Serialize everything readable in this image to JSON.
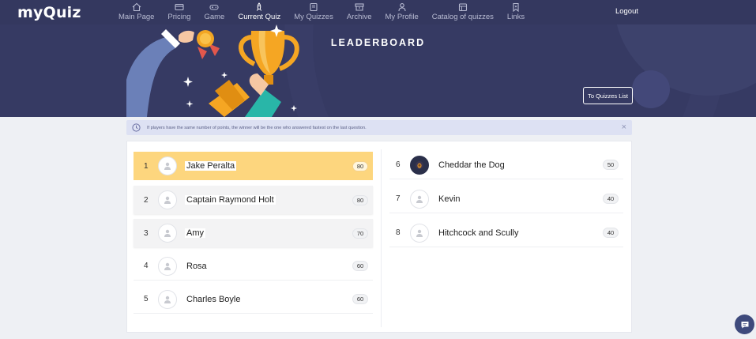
{
  "app": {
    "logo_text_1": "my",
    "logo_text_2": "Quiz"
  },
  "nav": {
    "items": [
      {
        "label": "Main Page",
        "icon": "home-icon"
      },
      {
        "label": "Pricing",
        "icon": "card-icon"
      },
      {
        "label": "Game",
        "icon": "gamepad-icon"
      },
      {
        "label": "Current Quiz",
        "icon": "rocket-icon",
        "active": true
      },
      {
        "label": "My Quizzes",
        "icon": "quizzes-icon"
      },
      {
        "label": "Archive",
        "icon": "archive-icon"
      },
      {
        "label": "My Profile",
        "icon": "user-icon"
      },
      {
        "label": "Catalog of quizzes",
        "icon": "catalog-icon"
      },
      {
        "label": "Links",
        "icon": "bookmark-icon"
      }
    ],
    "logout": "Logout"
  },
  "banner": {
    "title": "LEADERBOARD",
    "to_list_button": "To Quizzes List"
  },
  "info": {
    "text": "If players have the same number of points, the winner will be the one who answered fastest on the last question.",
    "close": "×"
  },
  "leaderboard": {
    "left": [
      {
        "rank": "1",
        "name": "Jake Peralta",
        "score": "80"
      },
      {
        "rank": "2",
        "name": "Captain Raymond Holt",
        "score": "80"
      },
      {
        "rank": "3",
        "name": "Amy",
        "score": "70"
      },
      {
        "rank": "4",
        "name": "Rosa",
        "score": "60"
      },
      {
        "rank": "5",
        "name": "Charles Boyle",
        "score": "60"
      }
    ],
    "right": [
      {
        "rank": "6",
        "name": "Cheddar the Dog",
        "score": "50"
      },
      {
        "rank": "7",
        "name": "Kevin",
        "score": "40"
      },
      {
        "rank": "8",
        "name": "Hitchcock and Scully",
        "score": "40"
      }
    ]
  },
  "colors": {
    "nav_bg": "#34385f",
    "banner_bg": "#363a63",
    "first_place": "#fdd67e",
    "info_bg": "#dde1f3"
  }
}
